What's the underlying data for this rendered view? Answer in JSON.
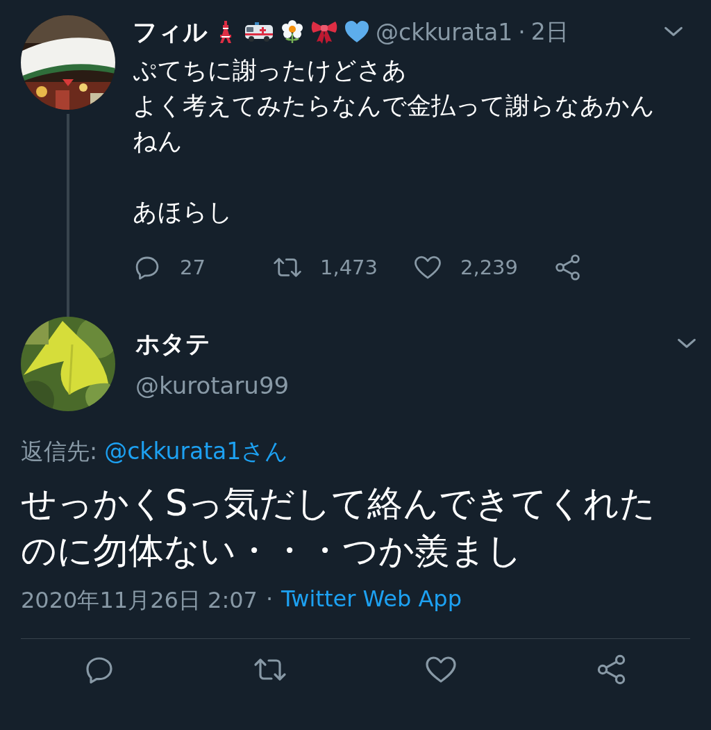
{
  "parent_tweet": {
    "name": "フィル",
    "handle": "@ckkurata1",
    "separator": "·",
    "time": "2日",
    "paragraphs": [
      [
        "ぷてちに謝ったけどさあ",
        "よく考えてみたらなんで金払って謝らなあかんねん"
      ],
      [
        "あほらし"
      ]
    ],
    "stats": {
      "replies": "27",
      "retweets": "1,473",
      "likes": "2,239"
    }
  },
  "focus_tweet": {
    "name": "ホタテ",
    "handle": "@kurotaru99",
    "reply_to_label": "返信先:",
    "reply_to_handle": "@ckkurata1さん",
    "text": "せっかくSっ気だして絡んできてくれたのに勿体ない・・・つか羨まし",
    "timestamp": "2020年11月26日 2:07",
    "separator": "·",
    "source": "Twitter Web App"
  }
}
